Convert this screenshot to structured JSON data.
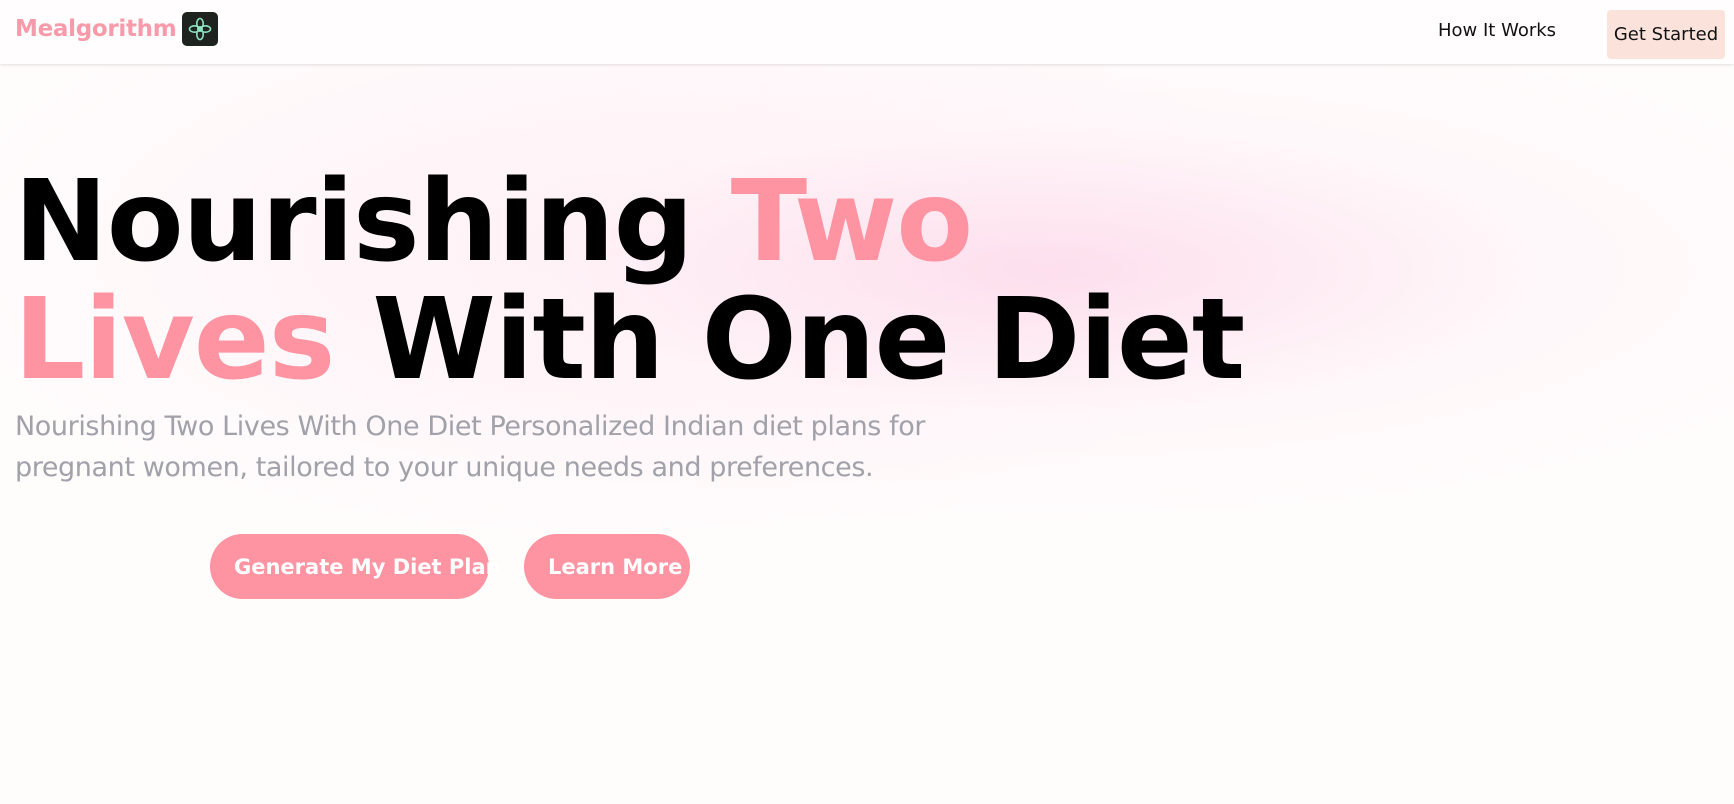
{
  "navbar": {
    "brand": "Mealgorithm",
    "links": [
      {
        "label": "How It Works"
      }
    ],
    "cta_label": "Get Started"
  },
  "hero": {
    "title_part1": "Nourishing ",
    "title_accent1": "Two",
    "title_accent2": "Lives",
    "title_part2": " With One Diet",
    "subtitle": "Nourishing Two Lives With One Diet Personalized Indian diet plans for pregnant women, tailored to your unique needs and preferences.",
    "primary_button": "Generate My Diet Plan",
    "secondary_button": "Learn More"
  },
  "icons": {
    "brand_logo": "flower-icon"
  },
  "colors": {
    "brand": "#f79aaa",
    "accent": "#fe93a1",
    "cta_background": "#fbe3dc",
    "subtitle": "#a1a1aa",
    "logo_background": "#1f2320"
  }
}
